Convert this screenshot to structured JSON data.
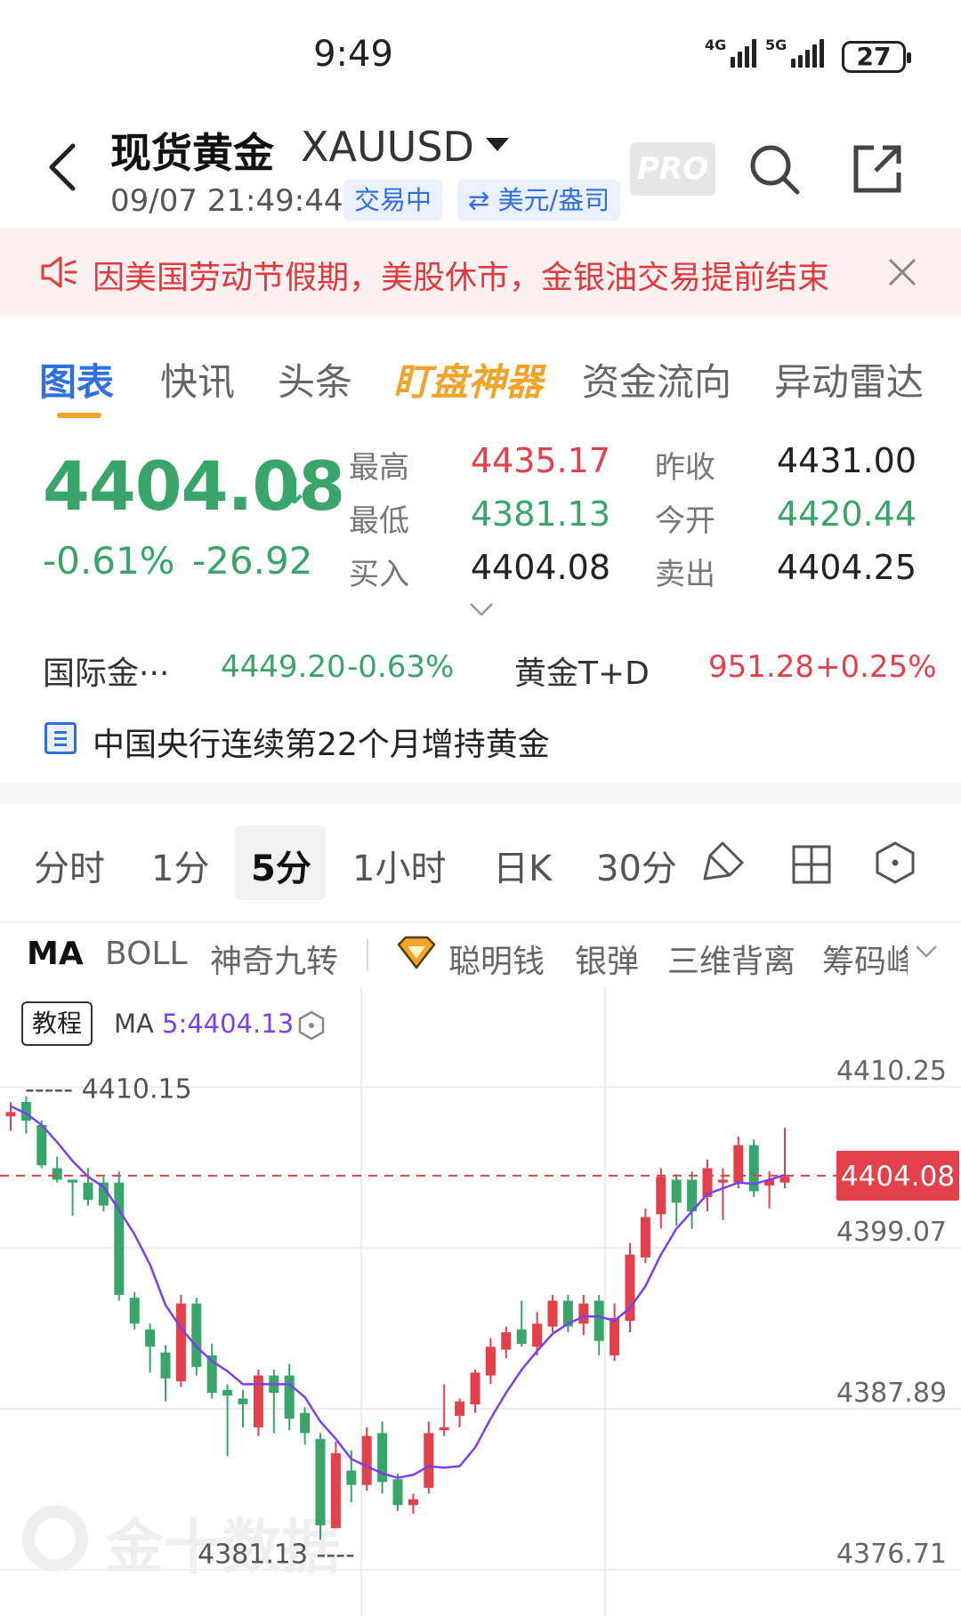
{
  "status_bar": {
    "time": "9:49",
    "network1": "4G",
    "network2": "5G",
    "battery": "27"
  },
  "header": {
    "title": "现货黄金",
    "symbol": "XAUUSD",
    "datetime": "09/07 21:49:44",
    "trading_status": "交易中",
    "unit": "⇄ 美元/盎司",
    "pro": "PRO"
  },
  "banner": {
    "text": "因美国劳动节假期，美股休市，金银油交易提前结束"
  },
  "tabs": [
    "图表",
    "快讯",
    "头条",
    "盯盘神器",
    "资金流向",
    "异动雷达"
  ],
  "quote": {
    "price": "4404.08",
    "arrow": "↓",
    "change_pct": "-0.61%",
    "change_abs": "-26.92",
    "high_label": "最高",
    "high": "4435.17",
    "low_label": "最低",
    "low": "4381.13",
    "bid_label": "买入",
    "bid": "4404.08",
    "prev_close_label": "昨收",
    "prev_close": "4431.00",
    "open_label": "今开",
    "open": "4420.44",
    "ask_label": "卖出",
    "ask": "4404.25"
  },
  "related": {
    "intl_name": "国际金···",
    "intl_price": "4449.20",
    "intl_pct": "-0.63%",
    "td_name": "黄金T+D",
    "td_price": "951.28",
    "td_pct": "+0.25%"
  },
  "news": {
    "text": "中国央行连续第22个月增持黄金"
  },
  "timeframes": [
    "分时",
    "1分",
    "5分",
    "1小时",
    "日K",
    "30分"
  ],
  "indicators": [
    "MA",
    "BOLL",
    "神奇九转",
    "聪明钱",
    "银弹",
    "三维背离",
    "筹码峰"
  ],
  "chart_toolbar": {
    "tutorial": "教程",
    "ma_label": "MA",
    "ma_value": "5:4404.13"
  },
  "colors": {
    "up": "#e2404a",
    "down": "#3aa56a",
    "accent": "#2f6fe0",
    "ma_line": "#7b3ff0",
    "highlight": "#f0a42a"
  },
  "chart_data": {
    "type": "candlestick",
    "interval": "5分",
    "y_ticks": [
      "4410.25",
      "4399.07",
      "4387.89",
      "4376.71"
    ],
    "ylim": [
      4376.71,
      4410.25
    ],
    "current_price": "4404.08",
    "marked_high": "4410.15",
    "marked_low": "4381.13",
    "watermark": "金十数据",
    "candles": [
      {
        "o": 4408.2,
        "h": 4409.2,
        "l": 4407.2,
        "c": 4408.5
      },
      {
        "o": 4409.2,
        "h": 4409.6,
        "l": 4407.0,
        "c": 4407.9
      },
      {
        "o": 4407.6,
        "h": 4407.9,
        "l": 4404.6,
        "c": 4404.8
      },
      {
        "o": 4404.6,
        "h": 4405.4,
        "l": 4403.6,
        "c": 4403.8
      },
      {
        "o": 4403.8,
        "h": 4403.8,
        "l": 4401.3,
        "c": 4403.6
      },
      {
        "o": 4403.6,
        "h": 4404.6,
        "l": 4402.0,
        "c": 4402.4
      },
      {
        "o": 4403.6,
        "h": 4404.0,
        "l": 4401.6,
        "c": 4402.0
      },
      {
        "o": 4403.6,
        "h": 4404.4,
        "l": 4395.4,
        "c": 4395.8
      },
      {
        "o": 4395.6,
        "h": 4396.0,
        "l": 4393.4,
        "c": 4393.8
      },
      {
        "o": 4393.4,
        "h": 4393.8,
        "l": 4390.4,
        "c": 4392.2
      },
      {
        "o": 4391.8,
        "h": 4392.3,
        "l": 4388.4,
        "c": 4390.0
      },
      {
        "o": 4389.8,
        "h": 4395.8,
        "l": 4389.4,
        "c": 4395.2
      },
      {
        "o": 4395.2,
        "h": 4395.6,
        "l": 4390.2,
        "c": 4390.8
      },
      {
        "o": 4391.6,
        "h": 4392.4,
        "l": 4388.6,
        "c": 4389.0
      },
      {
        "o": 4389.2,
        "h": 4389.6,
        "l": 4384.6,
        "c": 4388.8
      },
      {
        "o": 4388.6,
        "h": 4389.2,
        "l": 4386.6,
        "c": 4388.2
      },
      {
        "o": 4386.6,
        "h": 4390.6,
        "l": 4386.0,
        "c": 4390.2
      },
      {
        "o": 4390.2,
        "h": 4390.6,
        "l": 4386.2,
        "c": 4389.0
      },
      {
        "o": 4390.2,
        "h": 4391.0,
        "l": 4386.4,
        "c": 4387.2
      },
      {
        "o": 4387.6,
        "h": 4388.0,
        "l": 4385.4,
        "c": 4386.2
      },
      {
        "o": 4385.8,
        "h": 4386.2,
        "l": 4378.8,
        "c": 4379.8
      },
      {
        "o": 4379.6,
        "h": 4385.6,
        "l": 4379.6,
        "c": 4384.8
      },
      {
        "o": 4383.6,
        "h": 4385.0,
        "l": 4381.4,
        "c": 4382.6
      },
      {
        "o": 4382.6,
        "h": 4386.6,
        "l": 4382.2,
        "c": 4386.0
      },
      {
        "o": 4386.2,
        "h": 4387.0,
        "l": 4382.0,
        "c": 4382.8
      },
      {
        "o": 4383.0,
        "h": 4383.4,
        "l": 4380.8,
        "c": 4381.2
      },
      {
        "o": 4381.2,
        "h": 4382.0,
        "l": 4380.6,
        "c": 4381.6
      },
      {
        "o": 4382.4,
        "h": 4387.0,
        "l": 4382.0,
        "c": 4386.2
      },
      {
        "o": 4386.4,
        "h": 4389.6,
        "l": 4386.0,
        "c": 4386.6
      },
      {
        "o": 4387.4,
        "h": 4388.6,
        "l": 4386.6,
        "c": 4388.4
      },
      {
        "o": 4388.2,
        "h": 4390.6,
        "l": 4387.6,
        "c": 4390.4
      },
      {
        "o": 4390.2,
        "h": 4392.8,
        "l": 4389.6,
        "c": 4392.2
      },
      {
        "o": 4392.0,
        "h": 4393.6,
        "l": 4391.4,
        "c": 4393.2
      },
      {
        "o": 4393.4,
        "h": 4395.4,
        "l": 4392.2,
        "c": 4392.4
      },
      {
        "o": 4392.2,
        "h": 4394.6,
        "l": 4391.6,
        "c": 4393.8
      },
      {
        "o": 4393.6,
        "h": 4395.8,
        "l": 4393.2,
        "c": 4395.4
      },
      {
        "o": 4395.4,
        "h": 4395.8,
        "l": 4393.2,
        "c": 4393.6
      },
      {
        "o": 4393.8,
        "h": 4395.8,
        "l": 4393.0,
        "c": 4395.2
      },
      {
        "o": 4395.4,
        "h": 4395.8,
        "l": 4391.6,
        "c": 4392.6
      },
      {
        "o": 4391.6,
        "h": 4395.2,
        "l": 4391.2,
        "c": 4394.2
      },
      {
        "o": 4394.0,
        "h": 4399.4,
        "l": 4393.2,
        "c": 4398.6
      },
      {
        "o": 4398.4,
        "h": 4401.8,
        "l": 4398.0,
        "c": 4401.2
      },
      {
        "o": 4401.4,
        "h": 4404.6,
        "l": 4400.4,
        "c": 4404.0
      },
      {
        "o": 4403.8,
        "h": 4404.2,
        "l": 4400.6,
        "c": 4402.2
      },
      {
        "o": 4403.8,
        "h": 4404.4,
        "l": 4400.4,
        "c": 4401.6
      },
      {
        "o": 4402.6,
        "h": 4405.2,
        "l": 4401.6,
        "c": 4404.6
      },
      {
        "o": 4403.6,
        "h": 4404.6,
        "l": 4401.0,
        "c": 4403.8
      },
      {
        "o": 4403.6,
        "h": 4406.8,
        "l": 4403.2,
        "c": 4406.2
      },
      {
        "o": 4406.2,
        "h": 4406.6,
        "l": 4402.6,
        "c": 4403.0
      },
      {
        "o": 4403.4,
        "h": 4404.4,
        "l": 4401.8,
        "c": 4403.8
      },
      {
        "o": 4403.6,
        "h": 4407.4,
        "l": 4403.2,
        "c": 4404.0
      }
    ],
    "ma5": [
      4408.9,
      4408.4,
      4407.6,
      4406.4,
      4405.1,
      4404.0,
      4403.3,
      4401.7,
      4400.0,
      4397.9,
      4395.1,
      4393.5,
      4392.2,
      4391.2,
      4390.5,
      4389.6,
      4389.6,
      4389.6,
      4389.6,
      4388.7,
      4387.0,
      4385.8,
      4384.4,
      4383.9,
      4383.4,
      4383.1,
      4383.3,
      4383.9,
      4383.8,
      4383.9,
      4385.2,
      4387.2,
      4389.0,
      4390.6,
      4391.9,
      4393.1,
      4393.8,
      4394.3,
      4394.3,
      4394.0,
      4394.9,
      4396.4,
      4398.6,
      4400.4,
      4401.6,
      4402.8,
      4403.2,
      4403.6,
      4403.5,
      4403.8,
      4404.13
    ]
  }
}
